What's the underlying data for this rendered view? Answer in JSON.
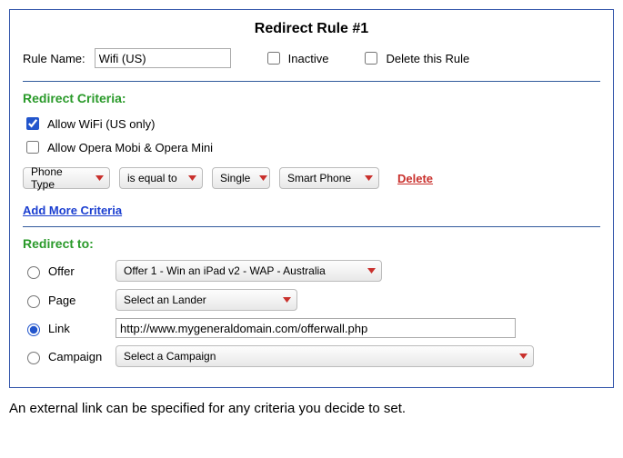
{
  "panel_title": "Redirect Rule #1",
  "rule_name": {
    "label": "Rule Name:",
    "value": "Wifi (US)"
  },
  "flags": {
    "inactive_label": "Inactive",
    "delete_label": "Delete this Rule"
  },
  "criteria": {
    "heading": "Redirect Criteria:",
    "allow_wifi_label": "Allow WiFi (US only)",
    "allow_opera_label": "Allow Opera Mobi & Opera Mini",
    "dd_phone_type": "Phone Type",
    "dd_equal": "is equal to",
    "dd_single": "Single",
    "dd_smart": "Smart Phone",
    "delete_link": "Delete",
    "add_more_link": "Add More Criteria"
  },
  "redirect_to": {
    "heading": "Redirect to:",
    "offer_label": "Offer",
    "offer_dd": "Offer 1 - Win an iPad v2 - WAP - Australia",
    "page_label": "Page",
    "page_dd": "Select an Lander",
    "link_label": "Link",
    "link_value": "http://www.mygeneraldomain.com/offerwall.php",
    "campaign_label": "Campaign",
    "campaign_dd": "Select a Campaign"
  },
  "caption": "An external link can be specified for any criteria you decide to set."
}
